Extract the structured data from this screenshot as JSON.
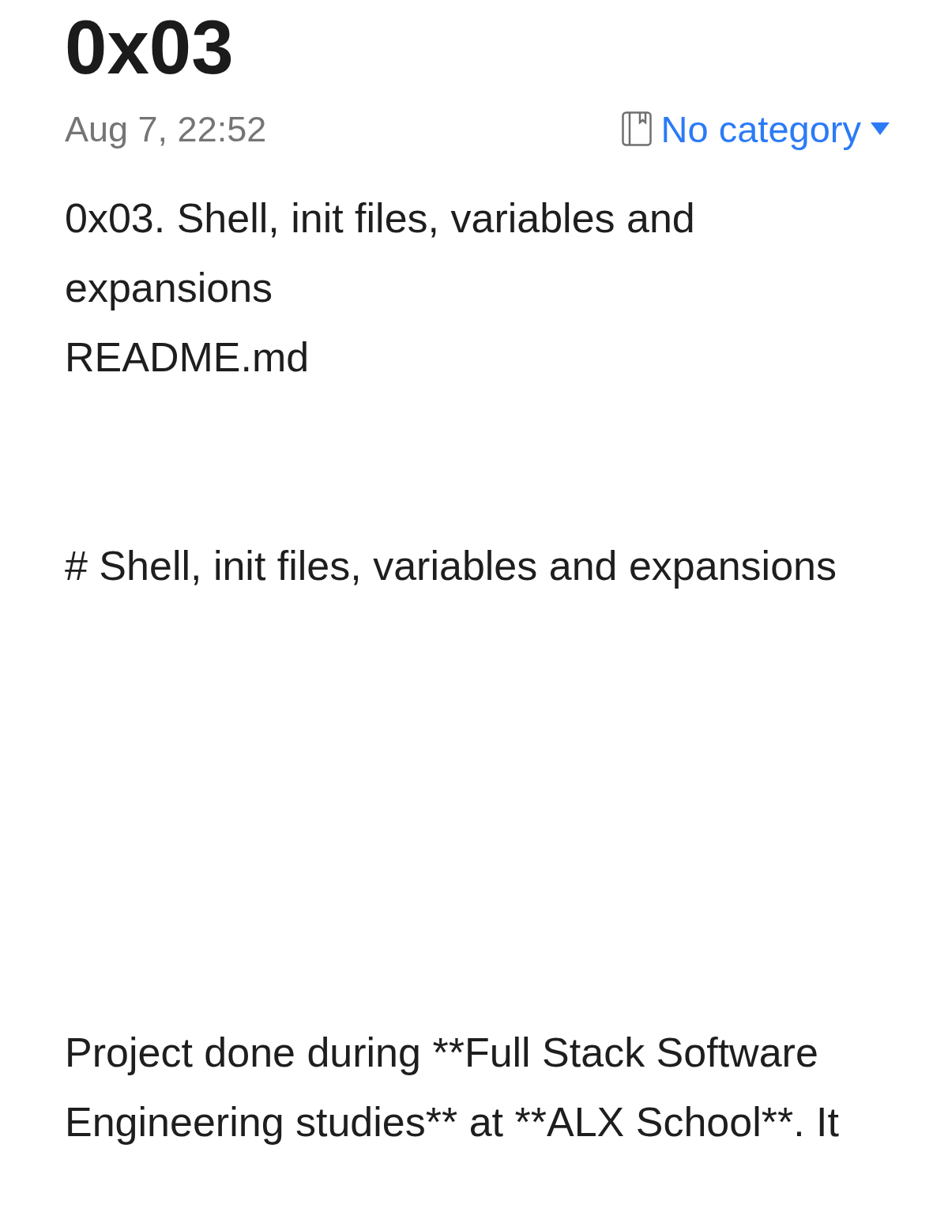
{
  "note": {
    "title": "0x03",
    "date": "Aug 7, 22:52",
    "category": {
      "label": "No category"
    },
    "paragraphs": [
      "0x03. Shell, init files, variables and expansions",
      "README.md",
      "# Shell, init files, variables and expansions",
      "Project done during **Full Stack Software Engineering studies** at **ALX School**. It"
    ]
  }
}
